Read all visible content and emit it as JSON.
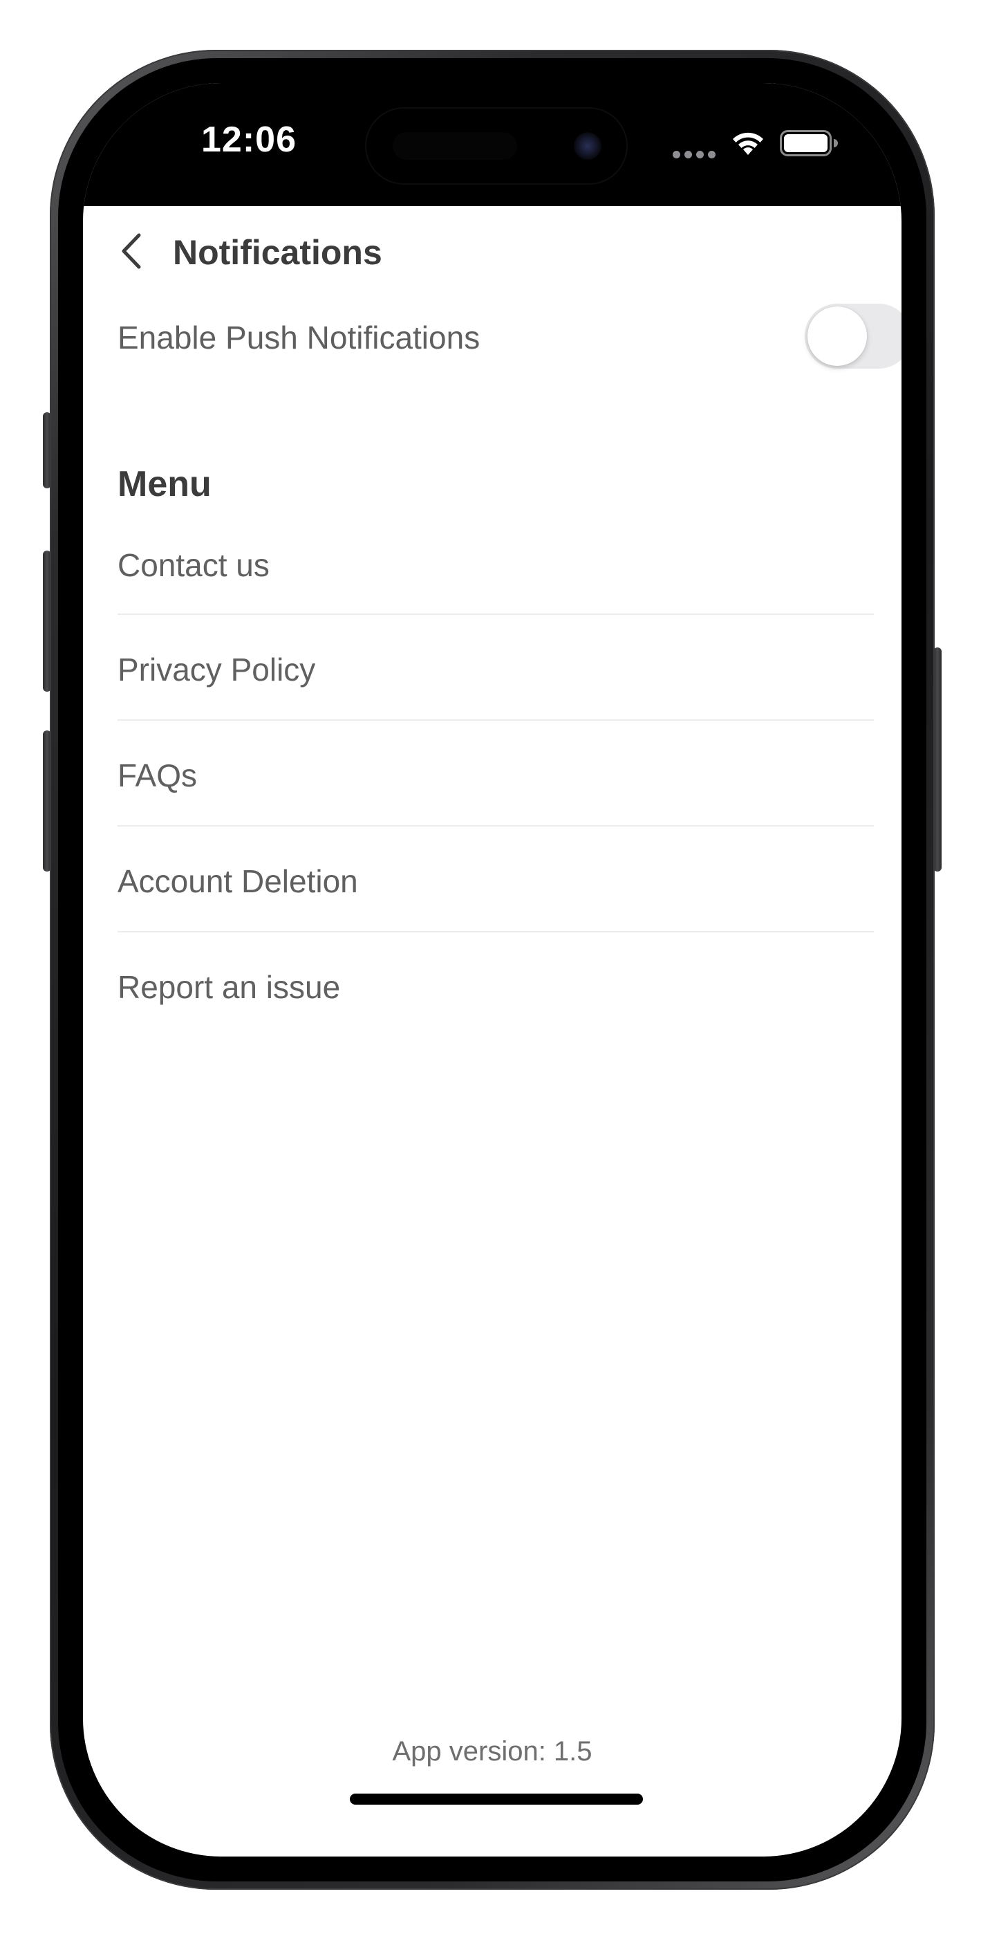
{
  "status_bar": {
    "time": "12:06"
  },
  "header": {
    "back_icon": "chevron-left-icon",
    "title": "Notifications"
  },
  "push_notifications": {
    "label": "Enable Push Notifications",
    "enabled": false
  },
  "menu": {
    "heading": "Menu",
    "items": [
      {
        "label": "Contact us"
      },
      {
        "label": "Privacy Policy"
      },
      {
        "label": "FAQs"
      },
      {
        "label": "Account Deletion"
      },
      {
        "label": "Report an issue"
      }
    ]
  },
  "footer": {
    "version_text": "App version: 1.5"
  },
  "colors": {
    "title_text": "#3c3c3c",
    "body_text": "#606060",
    "toggle_off": "#e9e9eb",
    "divider": "#ececec",
    "status_bar_bg": "#000000"
  }
}
